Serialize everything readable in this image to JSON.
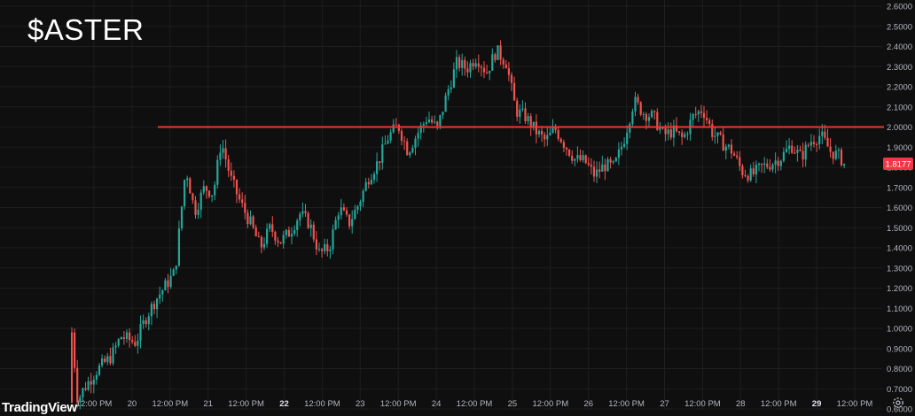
{
  "title": "$ASTER",
  "brand": "TradingView",
  "chart_data": {
    "type": "candlestick",
    "title": "$ASTER",
    "ylim": [
      0.55,
      2.62
    ],
    "y_ticks": [
      "0.6000",
      "0.7000",
      "0.8000",
      "0.9000",
      "1.0000",
      "1.1000",
      "1.2000",
      "1.3000",
      "1.4000",
      "1.5000",
      "1.6000",
      "1.7000",
      "1.8000",
      "1.9000",
      "2.0000",
      "2.1000",
      "2.2000",
      "2.3000",
      "2.4000",
      "2.5000",
      "2.6000"
    ],
    "x_labels": [
      "12:00 PM",
      "20",
      "12:00 PM",
      "21",
      "12:00 PM",
      "22",
      "12:00 PM",
      "23",
      "12:00 PM",
      "24",
      "12:00 PM",
      "25",
      "12:00 PM",
      "26",
      "12:00 PM",
      "27",
      "12:00 PM",
      "28",
      "12:00 PM",
      "29",
      "12:00 PM"
    ],
    "x_labels_bold": [
      false,
      false,
      false,
      false,
      false,
      true,
      false,
      false,
      false,
      false,
      false,
      false,
      false,
      false,
      false,
      false,
      false,
      false,
      false,
      true,
      false
    ],
    "current_price": "1.8177",
    "horizontal_level": 2.0,
    "price_path": [
      [
        0,
        0.98
      ],
      [
        0.6,
        0.64
      ],
      [
        1.2,
        0.7
      ],
      [
        2.5,
        0.79
      ],
      [
        4,
        0.86
      ],
      [
        5,
        0.96
      ],
      [
        6.5,
        0.93
      ],
      [
        7.5,
        1.05
      ],
      [
        8.5,
        1.14
      ],
      [
        9.5,
        1.21
      ],
      [
        10.5,
        1.28
      ],
      [
        11.6,
        1.8
      ],
      [
        12.5,
        1.58
      ],
      [
        13.5,
        1.7
      ],
      [
        14.4,
        1.67
      ],
      [
        15.2,
        1.93
      ],
      [
        16.2,
        1.74
      ],
      [
        17.2,
        1.62
      ],
      [
        18.2,
        1.52
      ],
      [
        19.2,
        1.4
      ],
      [
        20.2,
        1.5
      ],
      [
        21.2,
        1.43
      ],
      [
        22.2,
        1.48
      ],
      [
        23.2,
        1.57
      ],
      [
        24.2,
        1.52
      ],
      [
        25.2,
        1.37
      ],
      [
        26.2,
        1.4
      ],
      [
        27.2,
        1.6
      ],
      [
        28.2,
        1.52
      ],
      [
        29.2,
        1.62
      ],
      [
        30.2,
        1.75
      ],
      [
        31.2,
        1.83
      ],
      [
        32.2,
        1.95
      ],
      [
        33.2,
        2.01
      ],
      [
        34.2,
        1.88
      ],
      [
        35.2,
        1.97
      ],
      [
        36.2,
        2.05
      ],
      [
        37.2,
        1.99
      ],
      [
        38.2,
        2.17
      ],
      [
        39.2,
        2.32
      ],
      [
        40.2,
        2.29
      ],
      [
        41.2,
        2.35
      ],
      [
        42.2,
        2.27
      ],
      [
        43.2,
        2.38
      ],
      [
        44.2,
        2.32
      ],
      [
        45.2,
        2.08
      ],
      [
        46.2,
        2.05
      ],
      [
        47.2,
        1.98
      ],
      [
        48.2,
        1.93
      ],
      [
        49.2,
        1.99
      ],
      [
        50.2,
        1.91
      ],
      [
        51.2,
        1.84
      ],
      [
        52.2,
        1.83
      ],
      [
        53.2,
        1.76
      ],
      [
        54.2,
        1.81
      ],
      [
        55.2,
        1.8
      ],
      [
        56.2,
        1.94
      ],
      [
        57.2,
        2.13
      ],
      [
        58.2,
        2.07
      ],
      [
        59.2,
        2.05
      ],
      [
        60.2,
        1.96
      ],
      [
        61.2,
        1.98
      ],
      [
        62.2,
        1.94
      ],
      [
        63.2,
        2.05
      ],
      [
        64.2,
        2.09
      ],
      [
        65.2,
        1.97
      ],
      [
        66.2,
        1.92
      ],
      [
        67.2,
        1.88
      ],
      [
        68.2,
        1.78
      ],
      [
        69.2,
        1.76
      ],
      [
        70.2,
        1.8
      ],
      [
        71.2,
        1.82
      ],
      [
        72.2,
        1.85
      ],
      [
        73.2,
        1.91
      ],
      [
        74.2,
        1.85
      ],
      [
        75.2,
        1.93
      ],
      [
        76.2,
        1.96
      ],
      [
        77.2,
        1.88
      ],
      [
        78.2,
        1.85
      ],
      [
        78.6,
        1.8177
      ]
    ],
    "grid": true,
    "legend": "none"
  },
  "colors": {
    "background": "#0f0f0f",
    "grid": "#1e1e1e",
    "axis_text": "#b2b5be",
    "up": "#26a69a",
    "down": "#ef5350",
    "level_line": "#f23628",
    "price_label_bg": "#f23645",
    "price_label_text": "#ffffff"
  },
  "icons": {
    "settings": "gear-icon"
  }
}
